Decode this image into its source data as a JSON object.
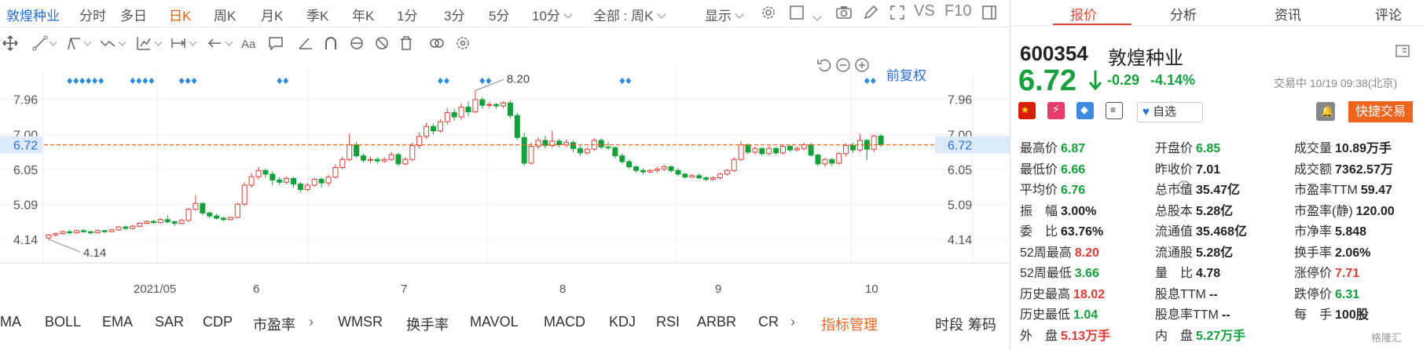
{
  "topbar": {
    "stock_name": "敦煌种业",
    "periods": [
      "分时",
      "多日",
      "日K",
      "周K",
      "月K",
      "季K",
      "年K",
      "1分",
      "3分",
      "5分",
      "10分"
    ],
    "active_period": "日K",
    "range_label": "全部 : 周K",
    "display_label": "显示",
    "vs_label": "VS",
    "f10_label": "F10"
  },
  "chart": {
    "fuquan_label": "前复权",
    "last_price_label": "6.72",
    "axis_left": [
      "7.96",
      "6.72",
      "6.05",
      "5.09",
      "4.14"
    ],
    "axis_right": [
      "7.96",
      "6.72",
      "6.05",
      "5.09",
      "4.14"
    ],
    "hidden_tick_label": "7.00",
    "x_labels": [
      "2021/05",
      "6",
      "7",
      "8",
      "9",
      "10"
    ],
    "max_label": "8.20",
    "min_label": "4.14"
  },
  "chart_data": {
    "type": "candlestick",
    "ylim": [
      3.5,
      8.7
    ],
    "y_ticks": [
      4.14,
      5.09,
      6.05,
      7.0,
      7.96
    ],
    "current_price": 6.72,
    "max": 8.2,
    "min": 4.14,
    "x_labels": [
      "2021/05",
      "6",
      "7",
      "8",
      "9",
      "10"
    ],
    "candles": [
      [
        4.18,
        4.26,
        4.14,
        4.28
      ],
      [
        4.26,
        4.3,
        4.22,
        4.33
      ],
      [
        4.3,
        4.35,
        4.27,
        4.38
      ],
      [
        4.35,
        4.32,
        4.28,
        4.4
      ],
      [
        4.32,
        4.38,
        4.3,
        4.4
      ],
      [
        4.38,
        4.35,
        4.32,
        4.42
      ],
      [
        4.35,
        4.32,
        4.28,
        4.38
      ],
      [
        4.32,
        4.38,
        4.3,
        4.41
      ],
      [
        4.38,
        4.35,
        4.32,
        4.4
      ],
      [
        4.35,
        4.4,
        4.33,
        4.43
      ],
      [
        4.4,
        4.48,
        4.38,
        4.51
      ],
      [
        4.48,
        4.44,
        4.4,
        4.52
      ],
      [
        4.44,
        4.5,
        4.42,
        4.54
      ],
      [
        4.5,
        4.58,
        4.47,
        4.6
      ],
      [
        4.58,
        4.63,
        4.55,
        4.66
      ],
      [
        4.63,
        4.6,
        4.56,
        4.68
      ],
      [
        4.6,
        4.68,
        4.58,
        4.72
      ],
      [
        4.68,
        4.62,
        4.58,
        4.8
      ],
      [
        4.62,
        4.58,
        4.5,
        4.66
      ],
      [
        4.58,
        4.66,
        4.55,
        4.7
      ],
      [
        4.66,
        4.96,
        4.62,
        5.0
      ],
      [
        4.96,
        5.12,
        4.92,
        5.35
      ],
      [
        5.12,
        4.86,
        4.8,
        5.15
      ],
      [
        4.86,
        4.78,
        4.72,
        4.9
      ],
      [
        4.78,
        4.72,
        4.68,
        4.84
      ],
      [
        4.72,
        4.68,
        4.64,
        4.76
      ],
      [
        4.68,
        4.74,
        4.66,
        4.76
      ],
      [
        4.74,
        5.1,
        4.72,
        5.14
      ],
      [
        5.1,
        5.62,
        5.05,
        5.7
      ],
      [
        5.62,
        5.85,
        5.55,
        5.95
      ],
      [
        5.85,
        6.02,
        5.78,
        6.12
      ],
      [
        6.02,
        5.92,
        5.82,
        6.08
      ],
      [
        5.92,
        5.76,
        5.62,
        6.0
      ],
      [
        5.76,
        5.7,
        5.62,
        5.84
      ],
      [
        5.7,
        5.8,
        5.64,
        5.86
      ],
      [
        5.8,
        5.65,
        5.55,
        5.84
      ],
      [
        5.65,
        5.5,
        5.42,
        5.7
      ],
      [
        5.5,
        5.62,
        5.45,
        5.68
      ],
      [
        5.62,
        5.78,
        5.58,
        5.82
      ],
      [
        5.78,
        5.68,
        5.55,
        5.84
      ],
      [
        5.68,
        5.84,
        5.6,
        5.9
      ],
      [
        5.84,
        6.1,
        5.8,
        6.18
      ],
      [
        6.1,
        6.32,
        6.05,
        6.4
      ],
      [
        6.32,
        6.72,
        6.28,
        7.02
      ],
      [
        6.72,
        6.42,
        6.36,
        6.8
      ],
      [
        6.42,
        6.3,
        6.24,
        6.48
      ],
      [
        6.3,
        6.32,
        6.22,
        6.4
      ],
      [
        6.32,
        6.28,
        6.2,
        6.38
      ],
      [
        6.28,
        6.32,
        6.22,
        6.38
      ],
      [
        6.32,
        6.45,
        6.28,
        6.52
      ],
      [
        6.45,
        6.2,
        6.14,
        6.5
      ],
      [
        6.2,
        6.32,
        6.16,
        6.38
      ],
      [
        6.32,
        6.7,
        6.28,
        6.78
      ],
      [
        6.7,
        6.95,
        6.62,
        7.05
      ],
      [
        6.95,
        7.22,
        6.88,
        7.32
      ],
      [
        7.22,
        7.1,
        7.0,
        7.3
      ],
      [
        7.1,
        7.35,
        7.05,
        7.42
      ],
      [
        7.35,
        7.6,
        7.28,
        7.72
      ],
      [
        7.6,
        7.48,
        7.38,
        7.7
      ],
      [
        7.48,
        7.75,
        7.4,
        7.85
      ],
      [
        7.75,
        7.62,
        7.5,
        7.9
      ],
      [
        7.62,
        7.95,
        7.58,
        8.2
      ],
      [
        7.95,
        7.8,
        7.7,
        8.02
      ],
      [
        7.8,
        7.82,
        7.72,
        7.88
      ],
      [
        7.82,
        7.78,
        7.7,
        7.86
      ],
      [
        7.78,
        7.86,
        7.72,
        7.9
      ],
      [
        7.86,
        7.52,
        7.45,
        7.94
      ],
      [
        7.52,
        6.92,
        6.85,
        7.6
      ],
      [
        6.92,
        6.22,
        6.15,
        7.05
      ],
      [
        6.22,
        6.68,
        6.18,
        6.78
      ],
      [
        6.68,
        6.84,
        6.6,
        6.92
      ],
      [
        6.84,
        6.7,
        6.62,
        6.96
      ],
      [
        6.7,
        6.82,
        6.64,
        7.1
      ],
      [
        6.82,
        6.72,
        6.65,
        6.88
      ],
      [
        6.72,
        6.78,
        6.66,
        6.86
      ],
      [
        6.78,
        6.62,
        6.52,
        6.84
      ],
      [
        6.62,
        6.5,
        6.42,
        6.7
      ],
      [
        6.5,
        6.6,
        6.45,
        6.66
      ],
      [
        6.6,
        6.84,
        6.55,
        6.9
      ],
      [
        6.84,
        6.66,
        6.6,
        6.9
      ],
      [
        6.66,
        6.64,
        6.58,
        6.8
      ],
      [
        6.64,
        6.42,
        6.35,
        6.68
      ],
      [
        6.42,
        6.26,
        6.2,
        6.48
      ],
      [
        6.26,
        6.12,
        6.06,
        6.32
      ],
      [
        6.12,
        6.02,
        5.95,
        6.16
      ],
      [
        6.02,
        5.98,
        5.92,
        6.08
      ],
      [
        5.98,
        6.02,
        5.94,
        6.06
      ],
      [
        6.02,
        6.06,
        5.96,
        6.12
      ],
      [
        6.06,
        6.12,
        6.0,
        6.16
      ],
      [
        6.12,
        6.02,
        5.96,
        6.16
      ],
      [
        6.02,
        5.92,
        5.86,
        6.08
      ],
      [
        5.92,
        5.84,
        5.8,
        5.96
      ],
      [
        5.84,
        5.88,
        5.82,
        5.92
      ],
      [
        5.88,
        5.82,
        5.78,
        5.94
      ],
      [
        5.82,
        5.78,
        5.72,
        5.86
      ],
      [
        5.78,
        5.82,
        5.74,
        5.86
      ],
      [
        5.82,
        5.92,
        5.78,
        5.96
      ],
      [
        5.92,
        6.02,
        5.88,
        6.06
      ],
      [
        6.02,
        6.32,
        5.98,
        6.38
      ],
      [
        6.32,
        6.72,
        6.28,
        6.82
      ],
      [
        6.72,
        6.52,
        6.46,
        6.76
      ],
      [
        6.52,
        6.62,
        6.46,
        6.68
      ],
      [
        6.62,
        6.48,
        6.42,
        6.66
      ],
      [
        6.48,
        6.62,
        6.44,
        6.68
      ],
      [
        6.62,
        6.5,
        6.44,
        6.66
      ],
      [
        6.5,
        6.68,
        6.46,
        6.72
      ],
      [
        6.68,
        6.58,
        6.52,
        6.72
      ],
      [
        6.58,
        6.62,
        6.54,
        6.68
      ],
      [
        6.62,
        6.72,
        6.56,
        6.78
      ],
      [
        6.72,
        6.44,
        6.38,
        6.78
      ],
      [
        6.44,
        6.2,
        6.14,
        6.48
      ],
      [
        6.2,
        6.32,
        6.12,
        6.36
      ],
      [
        6.32,
        6.22,
        6.14,
        6.36
      ],
      [
        6.22,
        6.48,
        6.18,
        6.52
      ],
      [
        6.48,
        6.7,
        6.4,
        6.76
      ],
      [
        6.7,
        6.58,
        6.5,
        6.78
      ],
      [
        6.58,
        6.84,
        6.52,
        7.02
      ],
      [
        6.84,
        6.6,
        6.3,
        6.88
      ],
      [
        6.6,
        6.96,
        6.52,
        7.0
      ],
      [
        6.96,
        6.72,
        6.66,
        7.02
      ]
    ],
    "event_marks": [
      {
        "pos": 3,
        "count": 6
      },
      {
        "pos": 12,
        "count": 4
      },
      {
        "pos": 19,
        "count": 3
      },
      {
        "pos": 33,
        "count": 2
      },
      {
        "pos": 56,
        "count": 2
      },
      {
        "pos": 62,
        "count": 2
      },
      {
        "pos": 82,
        "count": 2
      },
      {
        "pos": 117,
        "count": 2
      }
    ]
  },
  "indicators": {
    "items": [
      "MA",
      "BOLL",
      "EMA",
      "SAR",
      "CDP",
      "市盈率",
      "WMSR",
      "换手率",
      "MAVOL",
      "MACD",
      "KDJ",
      "RSI",
      "ARBR",
      "CR"
    ],
    "manage": "指标管理",
    "shiduan": "时段",
    "chouma": "筹码"
  },
  "panel": {
    "tabs": [
      "报价",
      "分析",
      "资讯",
      "评论"
    ],
    "code": "600354",
    "name": "敦煌种业",
    "price": "6.72",
    "change": "-0.29",
    "change_pct": "-4.14%",
    "trade_time": "交易中 10/19 09:38(北京)",
    "watch_label": "自选",
    "quick_trade": "快捷交易",
    "stats": [
      [
        {
          "k": "最高价",
          "v": "6.87",
          "c": "g"
        },
        {
          "k": "开盘价",
          "v": "6.85",
          "c": "g"
        },
        {
          "k": "成交量",
          "v": "10.89万手",
          "c": "k"
        }
      ],
      [
        {
          "k": "最低价",
          "v": "6.66",
          "c": "g"
        },
        {
          "k": "昨收价",
          "v": "7.01",
          "c": "k"
        },
        {
          "k": "成交额",
          "v": "7362.57万",
          "c": "k"
        }
      ],
      [
        {
          "k": "平均价",
          "v": "6.76",
          "c": "g"
        },
        {
          "k": "总市值",
          "v": "35.47亿",
          "c": "k"
        },
        {
          "k": "市盈率TTM",
          "v": "59.47",
          "c": "k"
        }
      ],
      [
        {
          "k": "振　幅",
          "v": "3.00%",
          "c": "k"
        },
        {
          "k": "总股本",
          "v": "5.28亿",
          "c": "k"
        },
        {
          "k": "市盈率(静)",
          "v": "120.00",
          "c": "k"
        }
      ],
      [
        {
          "k": "委　比",
          "v": "63.76%",
          "c": "k"
        },
        {
          "k": "流通值",
          "v": "35.468亿",
          "c": "k"
        },
        {
          "k": "市净率",
          "v": "5.848",
          "c": "k"
        }
      ],
      [
        {
          "k": "52周最高",
          "v": "8.20",
          "c": "r"
        },
        {
          "k": "流通股",
          "v": "5.28亿",
          "c": "k"
        },
        {
          "k": "换手率",
          "v": "2.06%",
          "c": "k"
        }
      ],
      [
        {
          "k": "52周最低",
          "v": "3.66",
          "c": "g"
        },
        {
          "k": "量　比",
          "v": "4.78",
          "c": "k"
        },
        {
          "k": "涨停价",
          "v": "7.71",
          "c": "r"
        }
      ],
      [
        {
          "k": "历史最高",
          "v": "18.02",
          "c": "r"
        },
        {
          "k": "股息TTM",
          "v": "--",
          "c": "k"
        },
        {
          "k": "跌停价",
          "v": "6.31",
          "c": "g"
        }
      ],
      [
        {
          "k": "历史最低",
          "v": "1.04",
          "c": "g"
        },
        {
          "k": "股息率TTM",
          "v": "--",
          "c": "k"
        },
        {
          "k": "每　手",
          "v": "100股",
          "c": "k"
        }
      ],
      [
        {
          "k": "外　盘",
          "v": "5.13万手",
          "c": "r"
        },
        {
          "k": "内　盘",
          "v": "5.27万手",
          "c": "g"
        },
        {
          "k": "",
          "v": "",
          "c": "k"
        }
      ]
    ],
    "watermark": "格隆汇"
  }
}
